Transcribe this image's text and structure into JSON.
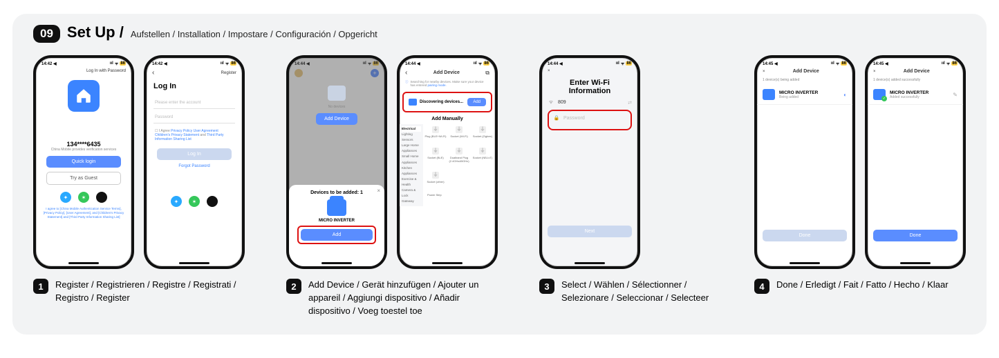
{
  "header": {
    "step": "09",
    "title": "Set Up /",
    "subtitle": "Aufstellen / Installation / Impostare / Configuración / Opgericht"
  },
  "captions": {
    "c1": "Register / Registrieren / Registre / Registrati / Registro / Register",
    "c2": "Add Device / Gerät hinzufügen / Ajouter un appareil / Aggiungi dispositivo / Añadir dispositivo / Voeg toestel toe",
    "c3": "Select / Wählen / Sélectionner / Selezionare / Seleccionar / Selecteer",
    "c4": "Done / Erledigt / Fait / Fatto / Hecho / Klaar"
  },
  "status": {
    "t1": "14:42",
    "t2": "14:44",
    "t3": "14:45",
    "loc": "◀",
    "sig": "ııl",
    "wifi": "ᯤ",
    "batt": "86"
  },
  "p1": {
    "top_right": "Log In with Password",
    "phone_masked": "134****6435",
    "provider": "China Mobile provides verification services",
    "quick": "Quick login",
    "guest": "Try as Guest",
    "legal": "I agree to [China Mobile Authentication Service Terms], [Privacy Policy], [User Agreement], and [Children's Privacy Statement] and [Third Party Information Sharing List]"
  },
  "p2": {
    "top_right": "Register",
    "title": "Log In",
    "ph_account": "Please enter the account",
    "ph_password": "Password",
    "agree_pre": "I Agree ",
    "pp": "Privacy Policy",
    "ua": "User Agreement",
    "cps": "Children's Privacy Statement",
    "tp": "Third Party Information Sharing List",
    "login": "Log In",
    "forgot": "Forgot Password"
  },
  "p3": {
    "no_dev": "No devices",
    "add": "Add Device",
    "sheet_title": "Devices to be added: 1",
    "dev": "MICRO INVERTER",
    "btn": "Add"
  },
  "p4": {
    "title": "Add Device",
    "banner": "Searching for nearby devices. Make sure your device has entered ",
    "pairing": "pairing mode.",
    "disc": "Discovering devices...",
    "add": "Add",
    "manual": "Add Manually",
    "side": [
      "Electrical",
      "Lighting",
      "Sensors",
      "Large Home Appliances",
      "Small Home Appliances",
      "Kitchen Appliances",
      "Exercise & Health",
      "Camera & Lock",
      "Gateway"
    ],
    "items": [
      "Plug (BLE+Wi-Fi)",
      "Socket (Wi-Fi)",
      "Socket (Zigbee)",
      "Socket (BLE)",
      "Dualband Plug (2.4GHz&5GHz)",
      "Socket (NB-IoT)",
      "Socket (other)",
      "",
      "",
      "Power Strip"
    ]
  },
  "p5": {
    "title": "Enter Wi-Fi Information",
    "ssid": "809",
    "pw": "Password",
    "next": "Next"
  },
  "p6": {
    "title": "Add Device",
    "sub": "1 device(s) being added",
    "dev": "MICRO INVERTER",
    "st": "Being added",
    "done": "Done"
  },
  "p7": {
    "title": "Add Device",
    "sub": "1 device(s) added successfully",
    "dev": "MICRO INVERTER",
    "st": "Added successfully",
    "done": "Done"
  }
}
